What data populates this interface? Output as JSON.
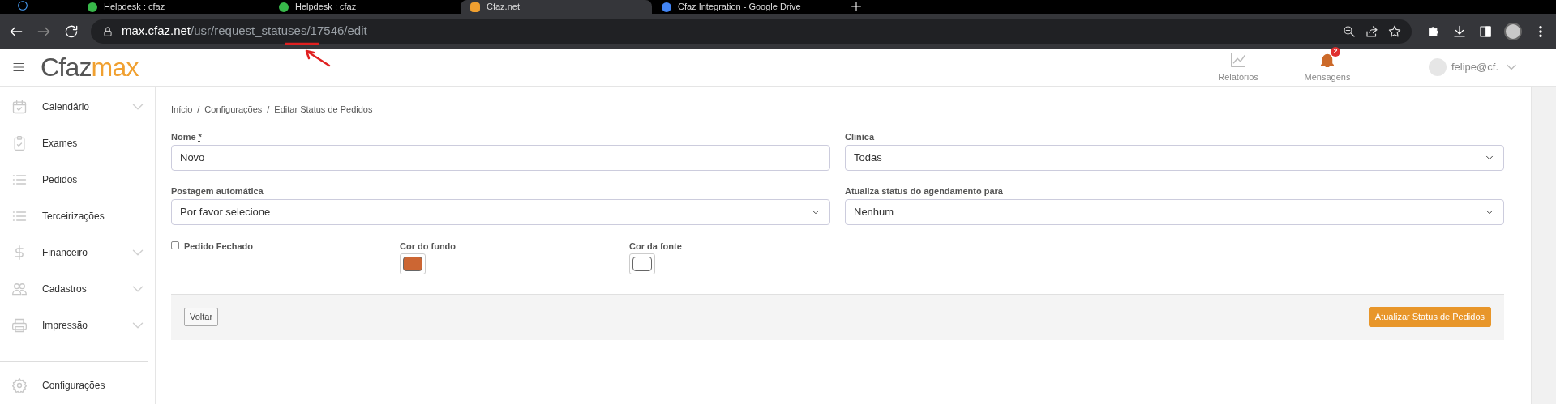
{
  "browser": {
    "tabs": [
      {
        "title": "Helpdesk : cfaz",
        "selected": false
      },
      {
        "title": "Helpdesk : cfaz",
        "selected": false
      },
      {
        "title": "Cfaz.net",
        "selected": true
      },
      {
        "title": "Cfaz Integration - Google Drive",
        "selected": false
      }
    ],
    "url_host": "max.cfaz.net",
    "url_path": "/usr/request_statuses/17546/edit"
  },
  "header": {
    "logo_main": "Cfaz",
    "logo_accent": "max",
    "links": [
      {
        "label": "Relatórios",
        "kind": "chart"
      },
      {
        "label": "Mensagens",
        "kind": "bell",
        "badge": "2"
      }
    ],
    "user": "felipe@cf."
  },
  "sidebar": {
    "items": [
      {
        "label": "Calendário",
        "expandable": true
      },
      {
        "label": "Exames",
        "expandable": false
      },
      {
        "label": "Pedidos",
        "expandable": false
      },
      {
        "label": "Terceirizações",
        "expandable": false
      },
      {
        "label": "Financeiro",
        "expandable": true
      },
      {
        "label": "Cadastros",
        "expandable": true
      },
      {
        "label": "Impressão",
        "expandable": true
      }
    ],
    "bottom_items": [
      {
        "label": "Configurações",
        "expandable": false
      }
    ]
  },
  "breadcrumb": {
    "separator": "/",
    "items": [
      "Início",
      "Configurações",
      "Editar Status de Pedidos"
    ]
  },
  "form": {
    "name": {
      "label": "Nome",
      "required_mark": "*",
      "value": "Novo"
    },
    "clinic": {
      "label": "Clínica",
      "value": "Todas"
    },
    "auto_post": {
      "label": "Postagem automática",
      "value": "Por favor selecione"
    },
    "schedule_status": {
      "label": "Atualiza status do agendamento para",
      "value": "Nenhum"
    },
    "closed": {
      "label": "Pedido Fechado",
      "checked": false
    },
    "background_color": {
      "label": "Cor do fundo",
      "color": "#cc6633"
    },
    "font_color": {
      "label": "Cor da fonte",
      "color": "#ffffff"
    }
  },
  "footer": {
    "back": "Voltar",
    "submit": "Atualizar Status de Pedidos"
  }
}
